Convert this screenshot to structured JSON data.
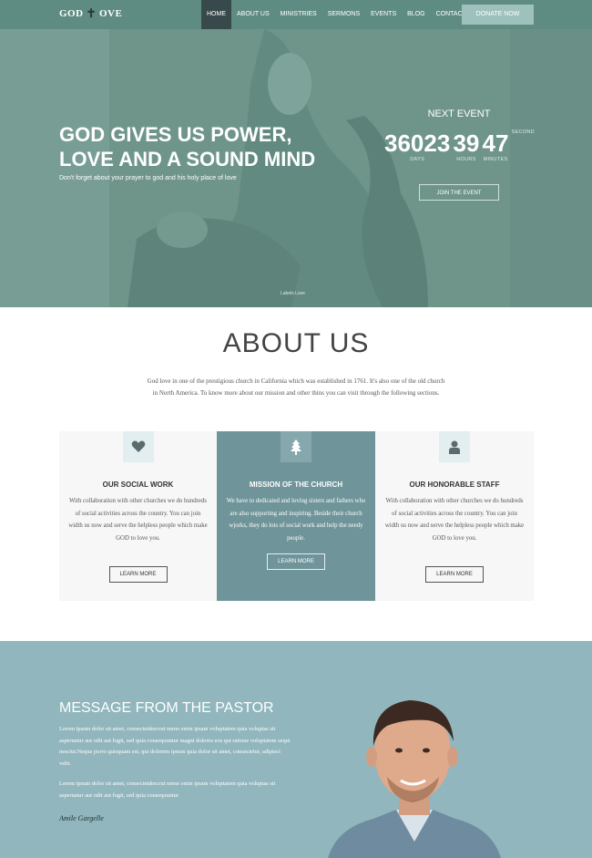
{
  "nav": {
    "logo": "GOD",
    "logo_suffix": "OVE",
    "items": [
      "HOME",
      "ABOUT US",
      "MINISTRIES",
      "SERMONS",
      "EVENTS",
      "BLOG",
      "CONTACT"
    ],
    "active": "HOME",
    "donate_label": "DONATE NOW"
  },
  "hero": {
    "title": "GOD GIVES US POWER, LOVE AND A SOUND MIND",
    "subtitle": "Don't forget about your prayer to god and his holy place of love",
    "next_event_label": "NEXT EVENT",
    "countdown": [
      {
        "value": "36023",
        "label": "DAYS"
      },
      {
        "value": "39",
        "label": "HOURS"
      },
      {
        "value": "47",
        "label": "MINUTES"
      },
      {
        "value": "",
        "label": "SECOND"
      }
    ],
    "join_label": "JOIN THE EVENT",
    "credit": "Labels Love"
  },
  "about": {
    "title": "ABOUT US",
    "text": "God love in one of the prestigious church in California which was established in 1761. It's also one of the old church in North America. To know more about our mission and other thins you can visit through the following sections.",
    "cards": [
      {
        "icon": "heart-icon",
        "title": "OUR SOCIAL WORK",
        "text": "With collaboration with other churches we do hundreds of social activities across the country. You can join width us now and serve the helpless people which make GOD to love you.",
        "button": "LEARN MORE"
      },
      {
        "icon": "tree-icon",
        "title": "MISSION OF THE CHURCH",
        "text": "We have to dedicated and loving sisters and fathers who are also supporting and inspiring. Beside their church wjorks, they do lots of social work and help the needy people.",
        "button": "LEARN MORE"
      },
      {
        "icon": "user-icon",
        "title": "OUR HONORABLE STAFF",
        "text": "With collaboration with other churches we do hundreds of social activities across the country. You can join width us now and serve the helpless people which make GOD to love you.",
        "button": "LEARN MORE"
      }
    ]
  },
  "pastor": {
    "title": "MESSAGE FROM THE PASTOR",
    "paragraph1": "Lorem ipsum dolor sit amet, consectetdescrut nemo enim ipsam voluptatem quia voluptas sit aspernatur aut odit aut fugit, sed quia consequuntur magni dolores eos qui ratione voluptatem sequi nesciut.Neque porro quisquam est, qui dolorem ipsum quia dolor sit amet, consectetur, adipisci velit.",
    "paragraph2": "Lorem ipsum dolor sit amet, consectetdescrut nemo enim ipsam voluptatem quia voluptas sit aspernatur aut odit aut fugit, sed quia consequuntur",
    "signature": "Amile Gargelle"
  },
  "colors": {
    "nav": "#5f8c82",
    "active_nav": "#37494a",
    "donate": "#9fc1bd",
    "hero_tint": "#6f958b",
    "mission_card": "#6f959a",
    "pastor_bg": "#91b6bd"
  }
}
